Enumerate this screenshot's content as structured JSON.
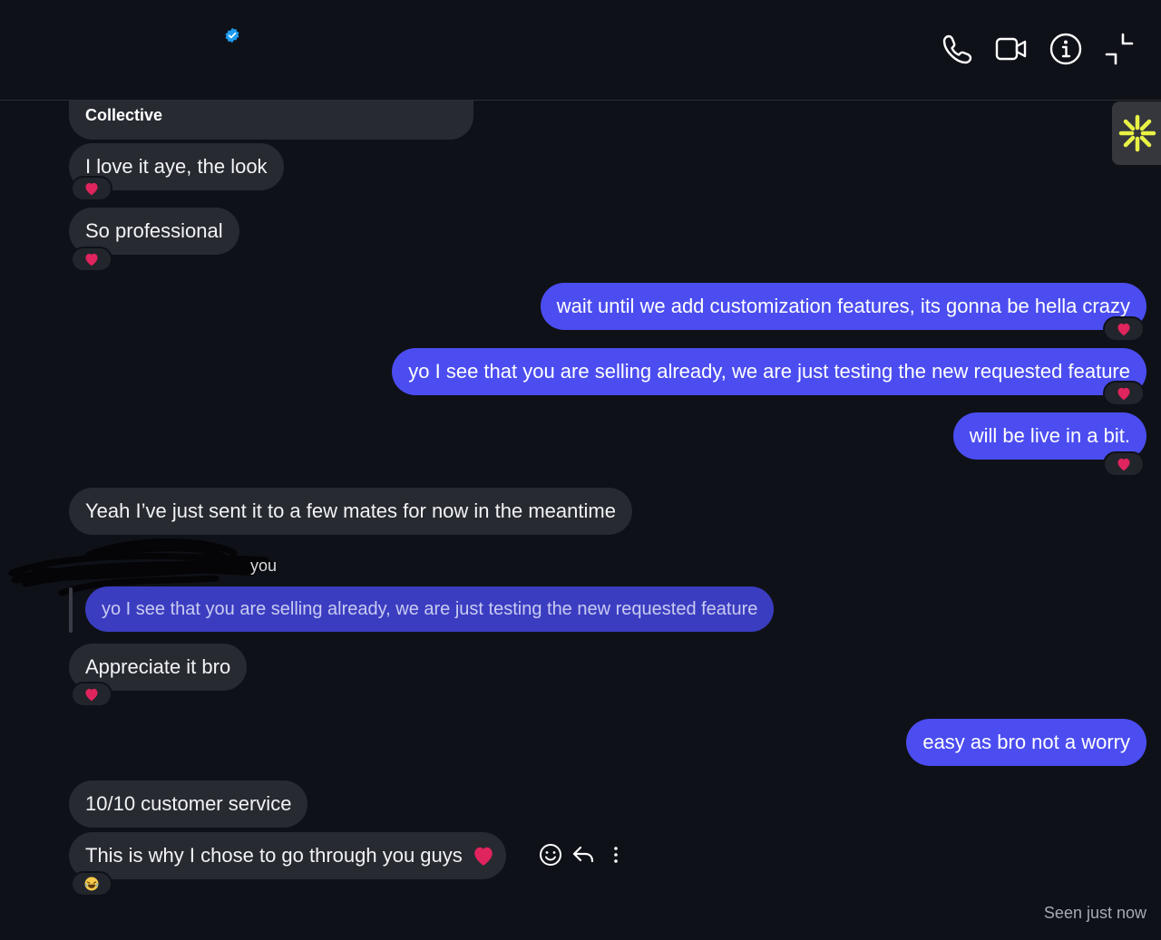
{
  "header": {
    "icons": [
      "verified-badge-icon",
      "phone-icon",
      "video-icon",
      "info-icon",
      "minimize-icon"
    ],
    "colors": {
      "verified": "#1d9bf0"
    }
  },
  "colors": {
    "background": "#0f1118",
    "incoming_bubble": "#272a31",
    "outgoing_bubble": "#4b4df0",
    "reaction_heart": "#e0245e",
    "sparkle": "#e8f245"
  },
  "messages": [
    {
      "id": "m0",
      "side": "in",
      "text": "Collective",
      "reaction": null
    },
    {
      "id": "m1",
      "side": "in",
      "text": "I love it aye, the look",
      "reaction": "heart"
    },
    {
      "id": "m2",
      "side": "in",
      "text": "So professional",
      "reaction": "heart"
    },
    {
      "id": "m3",
      "side": "out",
      "text": "wait until we add customization features, its gonna be hella crazy",
      "reaction": "heart"
    },
    {
      "id": "m4",
      "side": "out",
      "text": "yo I see that you are selling already, we are just testing the new requested feature",
      "reaction": "heart"
    },
    {
      "id": "m5",
      "side": "out",
      "text": "will be live in a bit.",
      "reaction": "heart"
    },
    {
      "id": "m6",
      "side": "in",
      "text": "Yeah I’ve just sent it to a few mates for now in the meantime",
      "reaction": null
    },
    {
      "id": "m7",
      "side": "in",
      "reply_label": "you",
      "quoted": "yo I see that you are selling already, we are just testing the new requested feature",
      "text": "Appreciate it bro",
      "reaction": "heart"
    },
    {
      "id": "m8",
      "side": "out",
      "text": "easy as bro not a worry",
      "reaction": null
    },
    {
      "id": "m9",
      "side": "in",
      "text": "10/10 customer service",
      "reaction": null
    },
    {
      "id": "m10",
      "side": "in",
      "text": "This is why I chose to go through you guys",
      "emoji": "heart",
      "reaction": "laugh"
    }
  ],
  "message_actions": [
    "emoji-react-icon",
    "reply-icon",
    "more-options-icon"
  ],
  "status": {
    "seen": "Seen just now"
  },
  "side_tab": {
    "icon": "sparkle-icon"
  }
}
